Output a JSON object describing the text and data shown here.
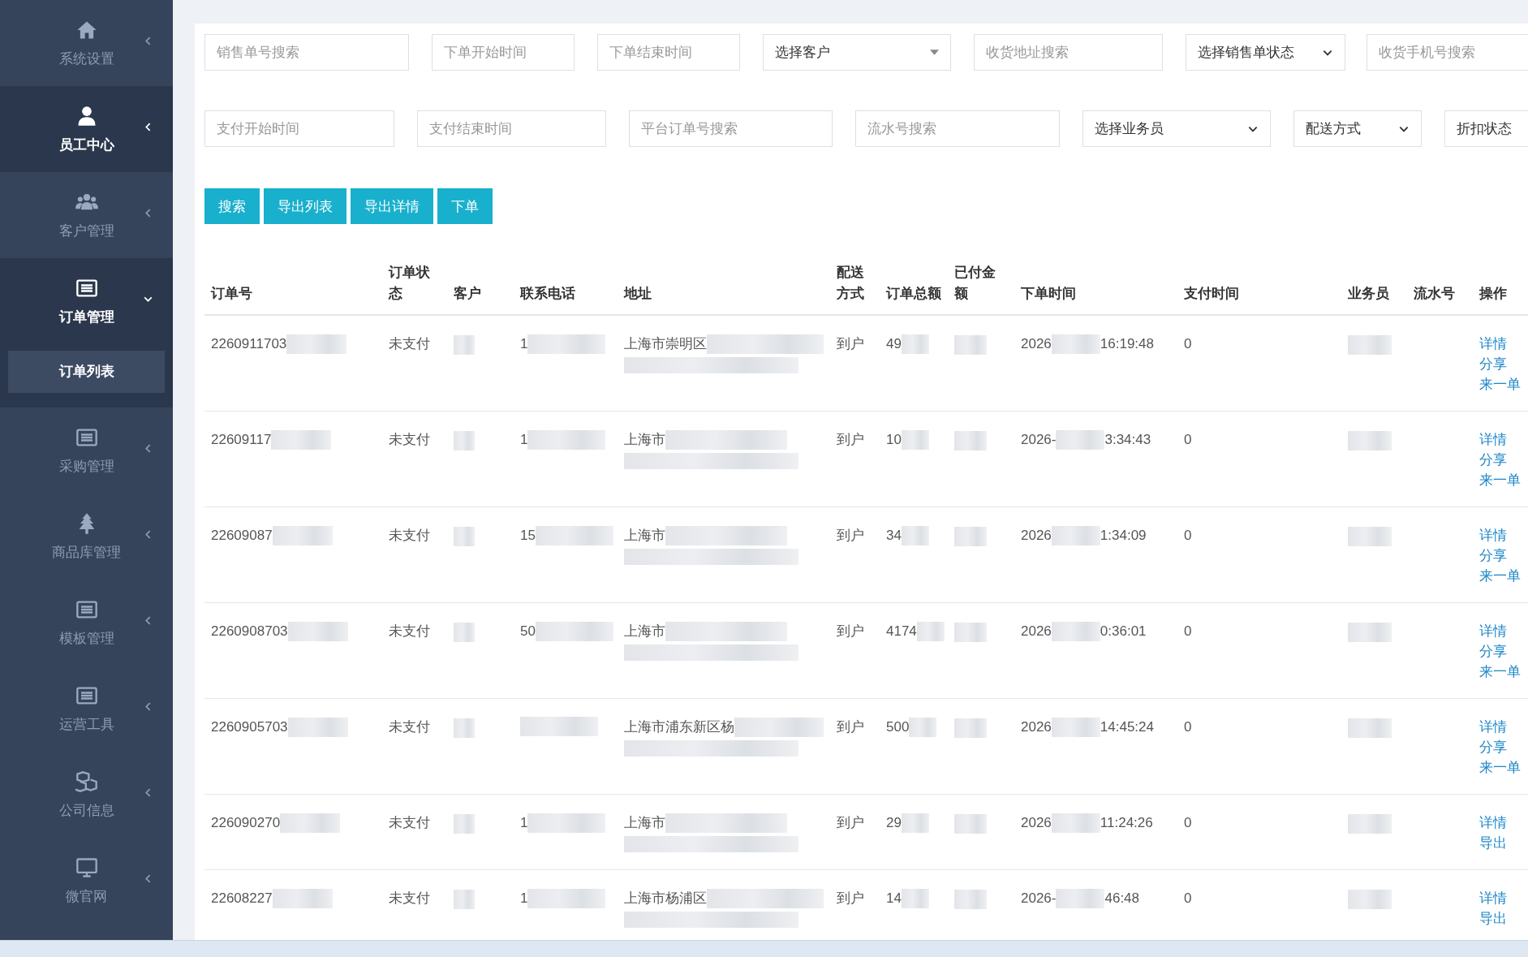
{
  "sidebar": {
    "items": [
      {
        "label": "系统设置",
        "highlighted": false,
        "expanded": false
      },
      {
        "label": "员工中心",
        "highlighted": true,
        "expanded": false
      },
      {
        "label": "客户管理",
        "highlighted": false,
        "expanded": false
      },
      {
        "label": "订单管理",
        "highlighted": true,
        "expanded": true,
        "children": [
          {
            "label": "订单列表",
            "selected": true
          }
        ]
      },
      {
        "label": "采购管理",
        "highlighted": false,
        "expanded": false
      },
      {
        "label": "商品库管理",
        "highlighted": false,
        "expanded": false
      },
      {
        "label": "模板管理",
        "highlighted": false,
        "expanded": false
      },
      {
        "label": "运营工具",
        "highlighted": false,
        "expanded": false
      },
      {
        "label": "公司信息",
        "highlighted": false,
        "expanded": false
      },
      {
        "label": "微官网",
        "highlighted": false,
        "expanded": false
      }
    ]
  },
  "filters": [
    [
      {
        "kind": "input",
        "placeholder": "销售单号搜索"
      },
      {
        "kind": "input",
        "placeholder": "下单开始时间"
      },
      {
        "kind": "input",
        "placeholder": "下单结束时间"
      },
      {
        "kind": "combo",
        "label": "选择客户"
      },
      {
        "kind": "input",
        "placeholder": "收货地址搜索"
      },
      {
        "kind": "select",
        "label": "选择销售单状态"
      },
      {
        "kind": "input",
        "placeholder": "收货手机号搜索"
      }
    ],
    [
      {
        "kind": "input",
        "placeholder": "支付开始时间"
      },
      {
        "kind": "input",
        "placeholder": "支付结束时间"
      },
      {
        "kind": "input",
        "placeholder": "平台订单号搜索"
      },
      {
        "kind": "input",
        "placeholder": "流水号搜索"
      },
      {
        "kind": "select",
        "label": "选择业务员"
      },
      {
        "kind": "select",
        "label": "配送方式"
      },
      {
        "kind": "select",
        "label": "折扣状态"
      }
    ]
  ],
  "buttons": [
    "搜索",
    "导出列表",
    "导出详情",
    "下单"
  ],
  "table": {
    "columns": [
      "订单号",
      "订单状态",
      "客户",
      "联系电话",
      "地址",
      "配送方式",
      "订单总额",
      "已付金额",
      "下单时间",
      "支付时间",
      "业务员",
      "流水号",
      "操作"
    ],
    "rows": [
      {
        "order_no": "2260911703",
        "status": "未支付",
        "phone": "1",
        "address": "上海市崇明区",
        "delivery": "到户",
        "total": "49",
        "order_date": "2026",
        "order_time": "16:19:48",
        "pay_time": "0",
        "actions": [
          "详情",
          "分享",
          "来一单"
        ]
      },
      {
        "order_no": "22609117",
        "status": "未支付",
        "phone": "1",
        "address": "上海市",
        "delivery": "到户",
        "total": "10",
        "order_date": "2026-",
        "order_time": "3:34:43",
        "pay_time": "0",
        "actions": [
          "详情",
          "分享",
          "来一单"
        ]
      },
      {
        "order_no": "22609087",
        "status": "未支付",
        "phone": "15",
        "address": "上海市",
        "delivery": "到户",
        "total": "34",
        "order_date": "2026",
        "order_time": "1:34:09",
        "pay_time": "0",
        "actions": [
          "详情",
          "分享",
          "来一单"
        ]
      },
      {
        "order_no": "2260908703",
        "status": "未支付",
        "phone": "50",
        "address": "上海市",
        "delivery": "到户",
        "total": "4174",
        "order_date": "2026",
        "order_time": "0:36:01",
        "pay_time": "0",
        "actions": [
          "详情",
          "分享",
          "来一单"
        ]
      },
      {
        "order_no": "2260905703",
        "status": "未支付",
        "phone": "",
        "address": "上海市浦东新区杨",
        "delivery": "到户",
        "total": "500",
        "order_date": "2026",
        "order_time": "14:45:24",
        "pay_time": "0",
        "actions": [
          "详情",
          "分享",
          "来一单"
        ]
      },
      {
        "order_no": "226090270",
        "status": "未支付",
        "phone": "1",
        "address": "上海市",
        "delivery": "到户",
        "total": "29",
        "order_date": "2026",
        "order_time": "11:24:26",
        "pay_time": "0",
        "actions": [
          "详情",
          "导出"
        ]
      },
      {
        "order_no": "22608227",
        "status": "未支付",
        "phone": "1",
        "address": "上海市杨浦区",
        "delivery": "到户",
        "total": "14",
        "order_date": "2026-",
        "order_time": "46:48",
        "pay_time": "0",
        "actions": [
          "详情",
          "导出"
        ]
      }
    ]
  }
}
